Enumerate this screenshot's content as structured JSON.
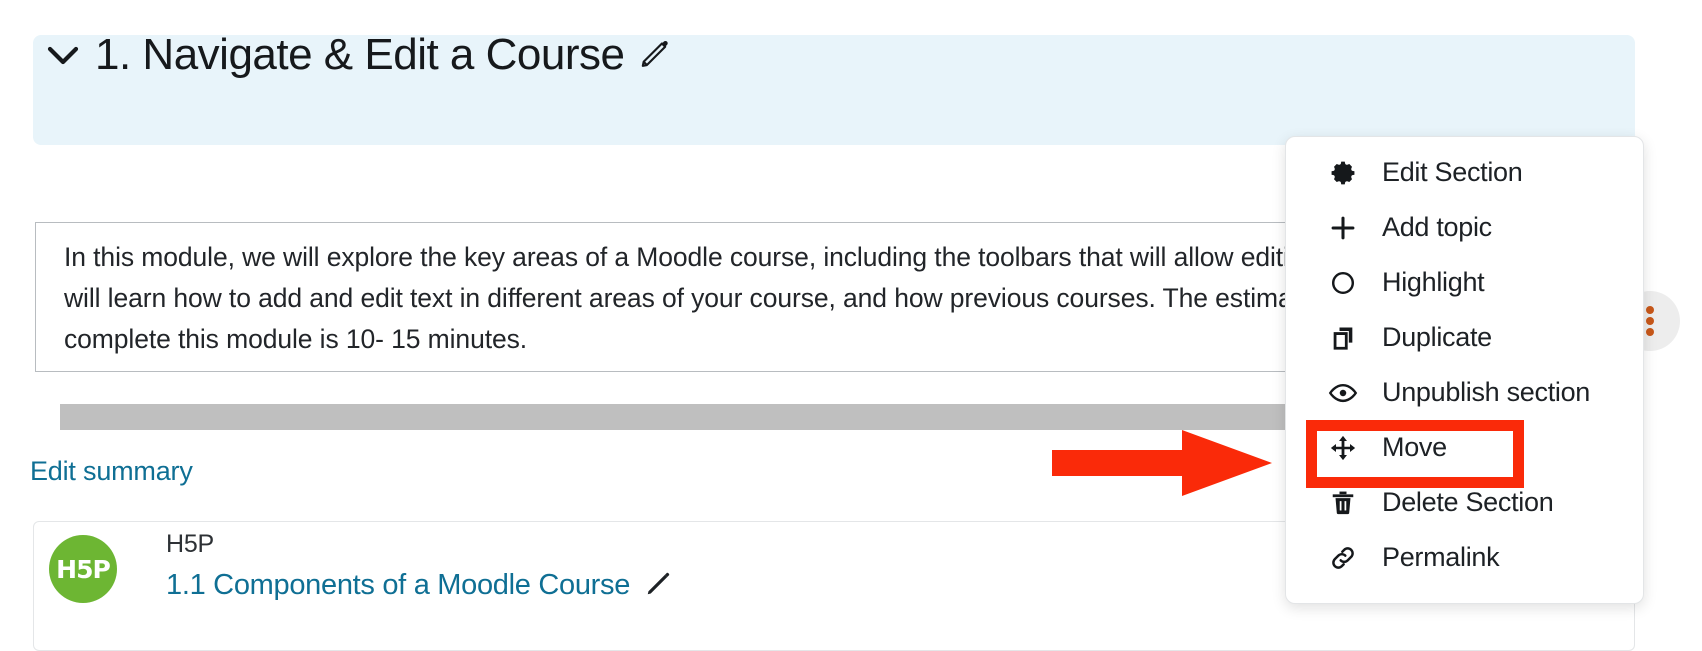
{
  "section": {
    "title": "1. Navigate & Edit a Course",
    "collapse_icon": "chevron-down-icon",
    "edit_title_icon": "pencil-icon",
    "header_bg": "#e8f4fa",
    "gear_icon": "gear-icon",
    "gear_color": "#0f7391",
    "kebab_icon": "three-dots-vertical-icon",
    "kebab_color": "#c8581a"
  },
  "summary": {
    "text": "In this module, we will explore the key areas of a Moodle course, including the toolbars that will allow editing your course. You will learn how to add and edit text in different areas of your course, and how previous courses. The estimated amount of time to complete this module is 10- 15 minutes.",
    "edit_link": "Edit summary",
    "link_color": "#0f6f94"
  },
  "activity": {
    "icon_label": "H5P",
    "icon_color": "#6db633",
    "type": "H5P",
    "name": "1.1 Components of a Moodle Course",
    "edit_icon": "pencil-icon"
  },
  "menu": {
    "items": [
      {
        "label": "Edit Section",
        "icon": "gear-icon"
      },
      {
        "label": "Add topic",
        "icon": "plus-icon"
      },
      {
        "label": "Highlight",
        "icon": "circle-icon"
      },
      {
        "label": "Duplicate",
        "icon": "duplicate-icon"
      },
      {
        "label": "Unpublish section",
        "icon": "eye-icon"
      },
      {
        "label": "Move",
        "icon": "move-arrows-icon"
      },
      {
        "label": "Delete Section",
        "icon": "trash-icon"
      },
      {
        "label": "Permalink",
        "icon": "link-icon"
      }
    ]
  },
  "annotation": {
    "color": "#fa2a09",
    "arrow": "right-arrow-annotation",
    "highlight_target": "Move"
  }
}
